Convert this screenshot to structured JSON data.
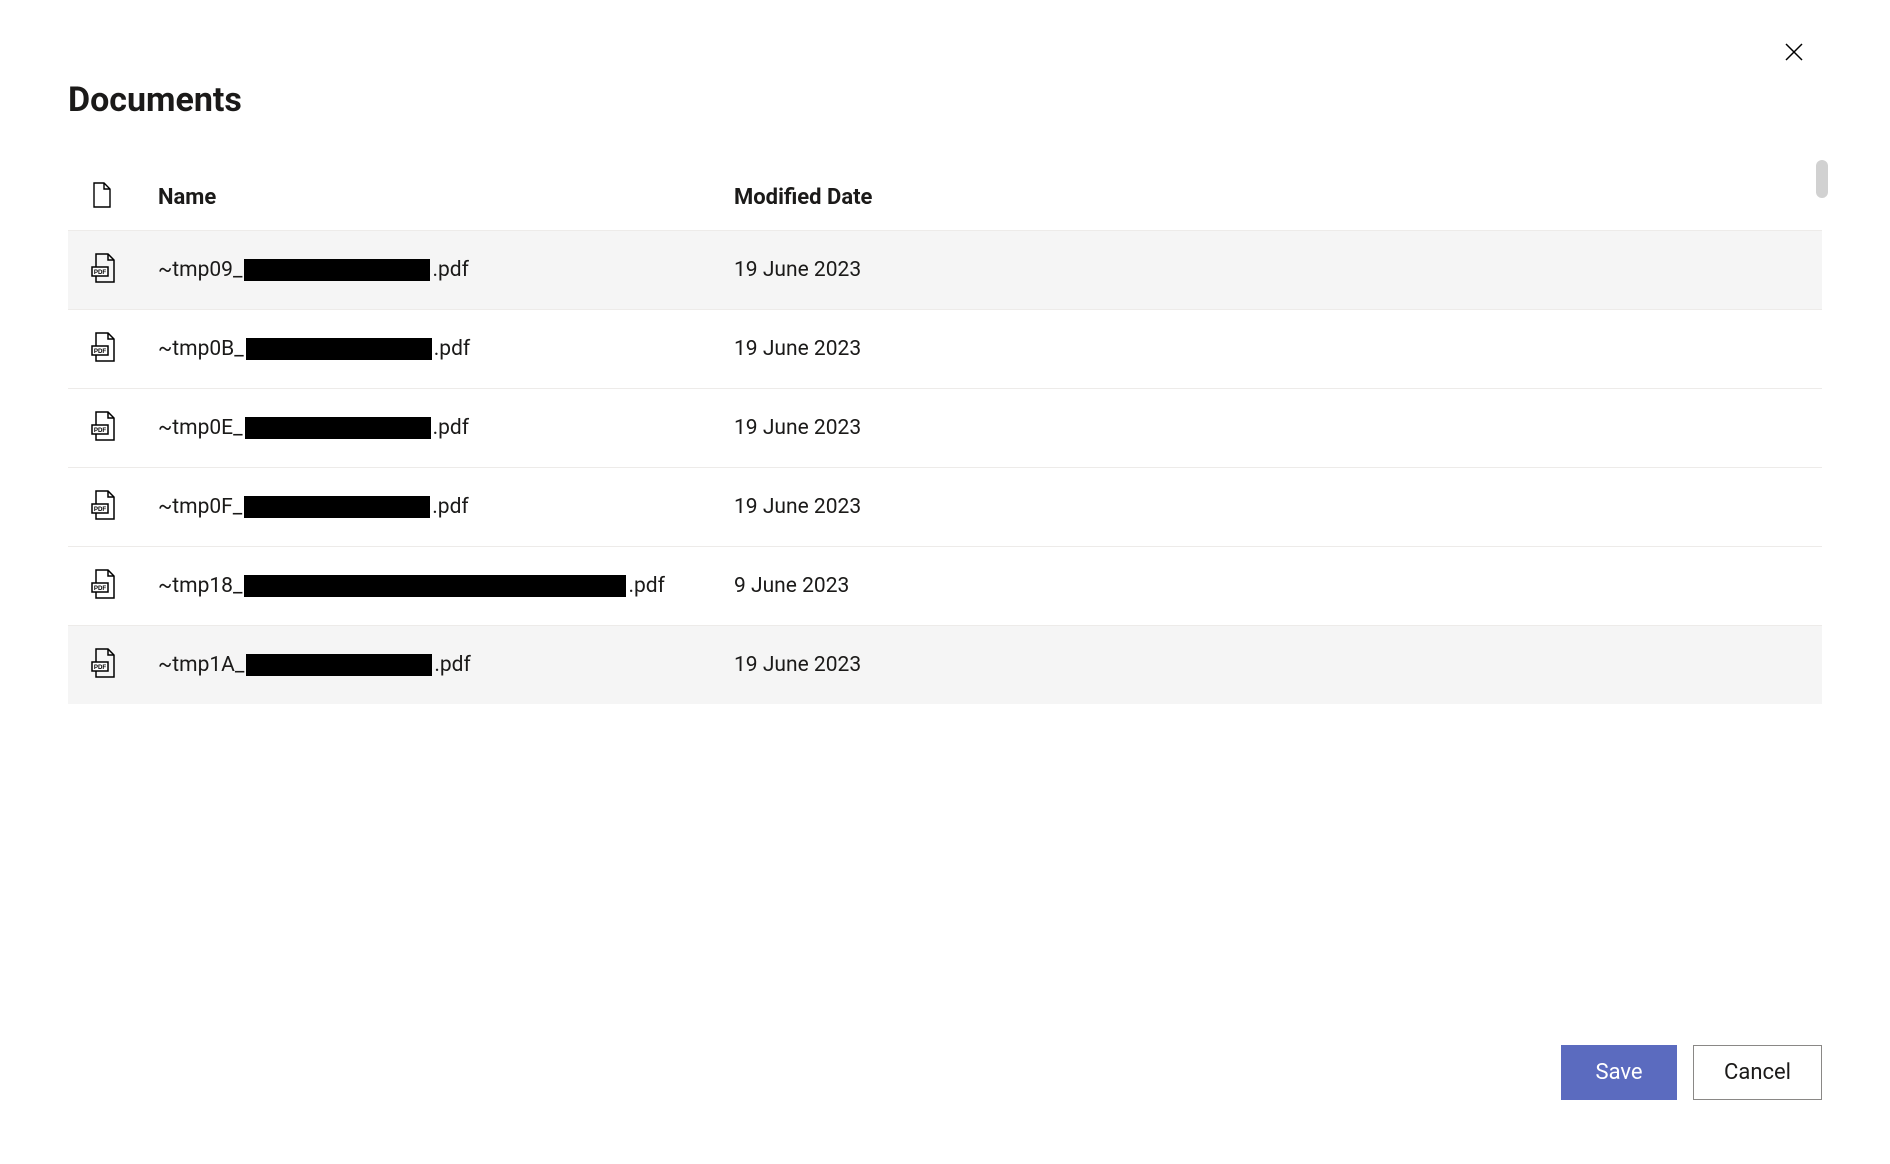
{
  "title": "Documents",
  "columns": {
    "name": "Name",
    "modified": "Modified Date"
  },
  "files": [
    {
      "prefix": "~tmp09_",
      "redacted_width": 186,
      "suffix": ".pdf",
      "modified": "19 June 2023",
      "highlighted": true
    },
    {
      "prefix": "~tmp0B_",
      "redacted_width": 186,
      "suffix": ".pdf",
      "modified": "19 June 2023",
      "highlighted": false
    },
    {
      "prefix": "~tmp0E_",
      "redacted_width": 186,
      "suffix": ".pdf",
      "modified": "19 June 2023",
      "highlighted": false
    },
    {
      "prefix": "~tmp0F_",
      "redacted_width": 186,
      "suffix": ".pdf",
      "modified": "19 June 2023",
      "highlighted": false
    },
    {
      "prefix": "~tmp18_",
      "redacted_width": 382,
      "suffix": ".pdf",
      "modified": "9 June 2023",
      "highlighted": false
    },
    {
      "prefix": "~tmp1A_",
      "redacted_width": 186,
      "suffix": ".pdf",
      "modified": "19 June 2023",
      "highlighted": true
    }
  ],
  "buttons": {
    "save": "Save",
    "cancel": "Cancel"
  }
}
